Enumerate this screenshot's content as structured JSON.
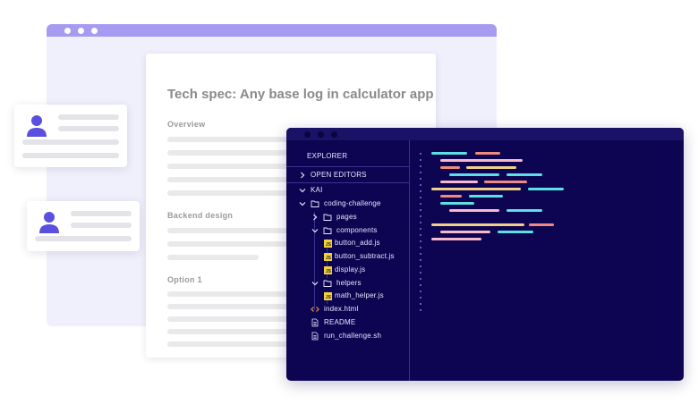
{
  "document": {
    "title": "Tech spec: Any base log in calculator app",
    "sections": [
      {
        "heading": "Overview"
      },
      {
        "heading": "Backend design"
      },
      {
        "heading": "Option 1"
      }
    ]
  },
  "editor": {
    "explorer_label": "EXPLORER",
    "open_editors_label": "OPEN EDITORS",
    "project_label": "KAI",
    "tree": {
      "root_folder": "coding-challenge",
      "pages_folder": "pages",
      "components_folder": "components",
      "components_files": [
        "button_add.js",
        "button_subtract.js",
        "display.js"
      ],
      "helpers_folder": "helpers",
      "helpers_files": [
        "math_helper.js"
      ],
      "root_files": [
        "index.html",
        "README",
        "run_challenge.sh"
      ]
    },
    "js_badge": "JS"
  },
  "colors": {
    "accent": "#5b4fe0",
    "editor_bg": "#0d0552",
    "browser_bar": "#a69bf0",
    "code_teal": "#5ce0e6",
    "code_salmon": "#f08a7e",
    "code_yellow": "#f2d08a",
    "code_pink": "#f7b8c8",
    "js_yellow": "#f2d23a",
    "html_orange": "#f0a030"
  },
  "icons": [
    "user-avatar-icon",
    "chevron-right-icon",
    "chevron-down-icon",
    "folder-icon",
    "js-file-icon",
    "html-code-icon",
    "document-icon"
  ]
}
